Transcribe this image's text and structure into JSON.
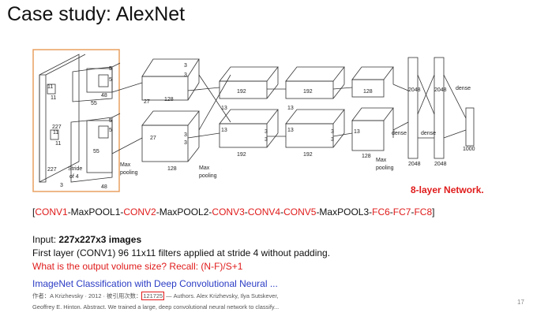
{
  "slide": {
    "title": "Case study: AlexNet",
    "network_label": "8-layer Network.",
    "layers": [
      {
        "text": "[",
        "color": "black"
      },
      {
        "text": "CONV1",
        "color": "red"
      },
      {
        "text": "-MaxPOOL1-",
        "color": "black"
      },
      {
        "text": "CONV2",
        "color": "red"
      },
      {
        "text": "-MaxPOOL2-",
        "color": "black"
      },
      {
        "text": "CONV3",
        "color": "red"
      },
      {
        "text": "-",
        "color": "black"
      },
      {
        "text": "CONV4",
        "color": "red"
      },
      {
        "text": "-",
        "color": "black"
      },
      {
        "text": "CONV5",
        "color": "red"
      },
      {
        "text": "-MaxPOOL3-",
        "color": "black"
      },
      {
        "text": "FC6",
        "color": "red"
      },
      {
        "text": "-",
        "color": "black"
      },
      {
        "text": "FC7",
        "color": "red"
      },
      {
        "text": "-",
        "color": "black"
      },
      {
        "text": "FC8",
        "color": "red"
      },
      {
        "text": "]",
        "color": "black"
      }
    ],
    "input_prefix": "Input: ",
    "input_value": "227x227x3 images",
    "first_layer": "First layer (CONV1) 96 11x11 filters applied at stride 4 without padding.",
    "question": "What is the output volume size? Recall: (N-F)/S+1",
    "paper_link": "ImageNet Classification with Deep Convolutional Neural ...",
    "meta_prefix": "作者：A Krizhevsky · 2012 · 被引用次数：",
    "citations": "121725",
    "meta_suffix": " — Authors. Alex Krizhevsky, Ilya Sutskever,",
    "meta_line2": "Geoffrey E. Hinton. Abstract. We trained a large, deep convolutional neural network to classify...",
    "page_number": "17"
  },
  "diagram": {
    "labels": {
      "in_227_a": "227",
      "in_227_b": "227",
      "in_3": "3",
      "in_11a": "11",
      "in_11b": "11",
      "in_11c": "11",
      "in_11d": "11",
      "stride": "Stride",
      "of4": "of 4",
      "c1_55a": "55",
      "c1_55b": "55",
      "c1_5a": "5",
      "c1_5b": "5",
      "c1_5c": "5",
      "c1_5d": "5",
      "c1_48a": "48",
      "c1_48b": "48",
      "c2_27a": "27",
      "c2_27b": "27",
      "c2_3a": "3",
      "c2_3b": "3",
      "c2_3c": "3",
      "c2_3d": "3",
      "c2_128a": "128",
      "c2_128b": "128",
      "c3_13a": "13",
      "c3_13b": "13",
      "c3_3a": "3",
      "c3_3b": "3",
      "c3_192a": "192",
      "c3_192b": "192",
      "c4_13a": "13",
      "c4_13b": "13",
      "c4_3a": "3",
      "c4_3b": "3",
      "c4_192a": "192",
      "c4_192b": "192",
      "c5_13": "13",
      "c5_128a": "128",
      "c5_128b": "128",
      "maxpool1": "Max",
      "pooling1": "pooling",
      "maxpool2": "Max",
      "pooling2": "pooling",
      "maxpool3": "Max",
      "pooling3": "pooling",
      "fc_2048a": "2048",
      "fc_2048b": "2048",
      "fc_2048c": "2048",
      "fc_2048d": "2048",
      "dense1": "dense",
      "dense2": "dense",
      "dense3": "dense",
      "out_1000": "1000"
    }
  }
}
